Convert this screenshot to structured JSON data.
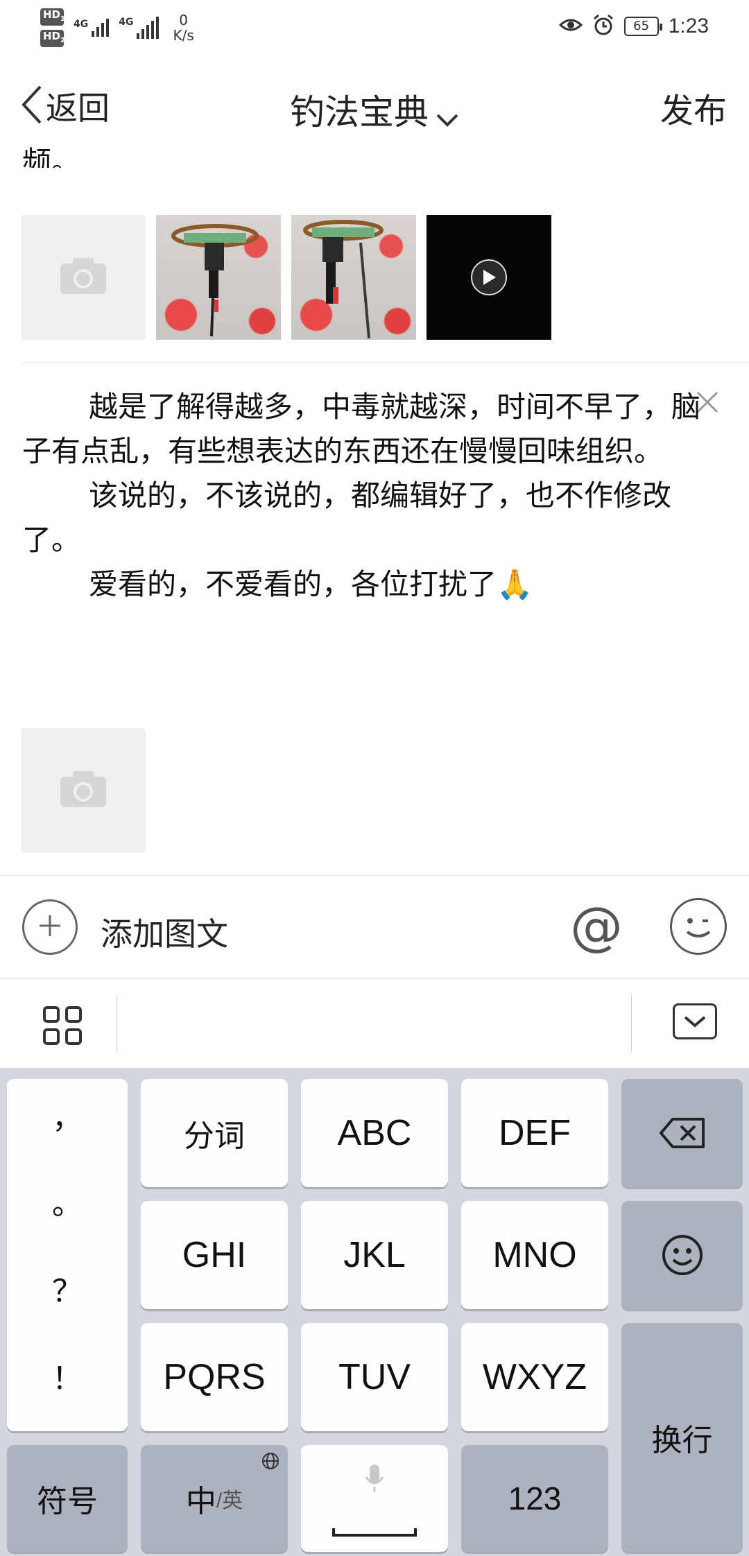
{
  "status_bar": {
    "hd1": "HD",
    "hd1_sub": "1",
    "hd2": "HD",
    "hd2_sub": "2",
    "signal1_label": "4G",
    "signal2_label": "4G",
    "net_speed_value": "0",
    "net_speed_unit": "K/s",
    "battery": "65",
    "time": "1:23"
  },
  "nav": {
    "back_label": "返回",
    "title": "钓法宝典",
    "publish_label": "发布"
  },
  "content": {
    "cut_off_text": "频。",
    "paragraphs": [
      "越是了解得越多，中毒就越深，时间不早了，脑子有点乱，有些想表达的东西还在慢慢回味组织。",
      "该说的，不该说的，都编辑好了，也不作修改了。",
      "爱看的，不爱看的，各位打扰了"
    ],
    "paragraph_emoji": "🙏"
  },
  "compose_bar": {
    "add_label": "添加图文"
  },
  "keyboard": {
    "punctuation": [
      "，",
      "。",
      "？",
      "！"
    ],
    "rows": [
      [
        "分词",
        "ABC",
        "DEF"
      ],
      [
        "GHI",
        "JKL",
        "MNO"
      ],
      [
        "PQRS",
        "TUV",
        "WXYZ"
      ]
    ],
    "symbols_label": "符号",
    "lang_main": "中",
    "lang_alt": "/英",
    "numbers_label": "123",
    "enter_label": "换行"
  },
  "colors": {
    "keyboard_bg": "#d3d6de",
    "key_light": "#fefefe",
    "key_dark": "#acb3bf"
  }
}
